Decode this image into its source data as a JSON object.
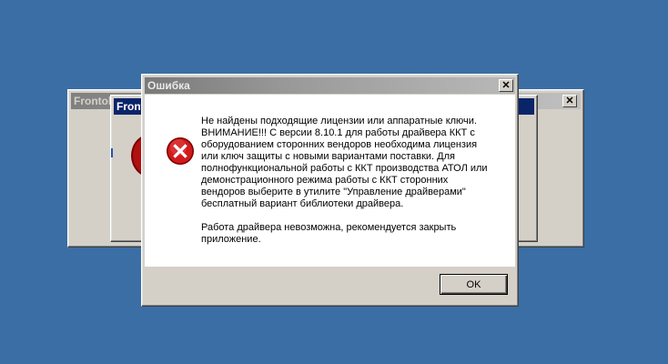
{
  "background_windows": {
    "back": {
      "title": "Frontol"
    },
    "middle": {
      "title": "Fronto"
    }
  },
  "dialog": {
    "title": "Ошибка",
    "close_glyph": "✕",
    "message": "Не найдены подходящие лицензии или аппаратные ключи.\nВНИМАНИЕ!!! С версии 8.10.1 для работы драйвера ККТ с оборудованием сторонних вендоров необходима лицензия или ключ защиты с новыми вариантами поставки. Для полнофункциональной работы с ККТ производства АТОЛ или демонстрационного режима работы с ККТ сторонних вендоров выберите в утилите \"Управление драйверами\" бесплатный вариант библиотеки драйвера.\n\nРабота драйвера невозможна, рекомендуется закрыть приложение.",
    "ok_label": "OK",
    "icon": "error-icon"
  },
  "colors": {
    "desktop": "#3a6ea5",
    "error_red": "#d11a1a"
  }
}
